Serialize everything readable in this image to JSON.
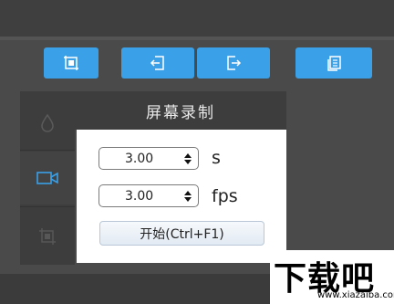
{
  "toolbar": {
    "buttons": [
      {
        "name": "capture",
        "icon": "screen-capture-icon"
      },
      {
        "name": "import",
        "icon": "import-icon"
      },
      {
        "name": "export",
        "icon": "export-icon"
      },
      {
        "name": "documents",
        "icon": "documents-icon"
      }
    ],
    "accent": "#3aa0e8"
  },
  "sidebar": {
    "items": [
      {
        "icon": "water-drop-icon"
      },
      {
        "icon": "video-camera-icon",
        "accent": "#3aa0e8"
      },
      {
        "icon": "crop-icon"
      }
    ]
  },
  "panel": {
    "title": "屏幕录制"
  },
  "recording": {
    "duration": {
      "value": "3.00",
      "unit": "s"
    },
    "framerate": {
      "value": "3.00",
      "unit": "fps"
    },
    "start_label": "开始(Ctrl+F1)"
  },
  "watermark": {
    "main": "下载吧",
    "sub": "www.xiazaiba.com"
  }
}
